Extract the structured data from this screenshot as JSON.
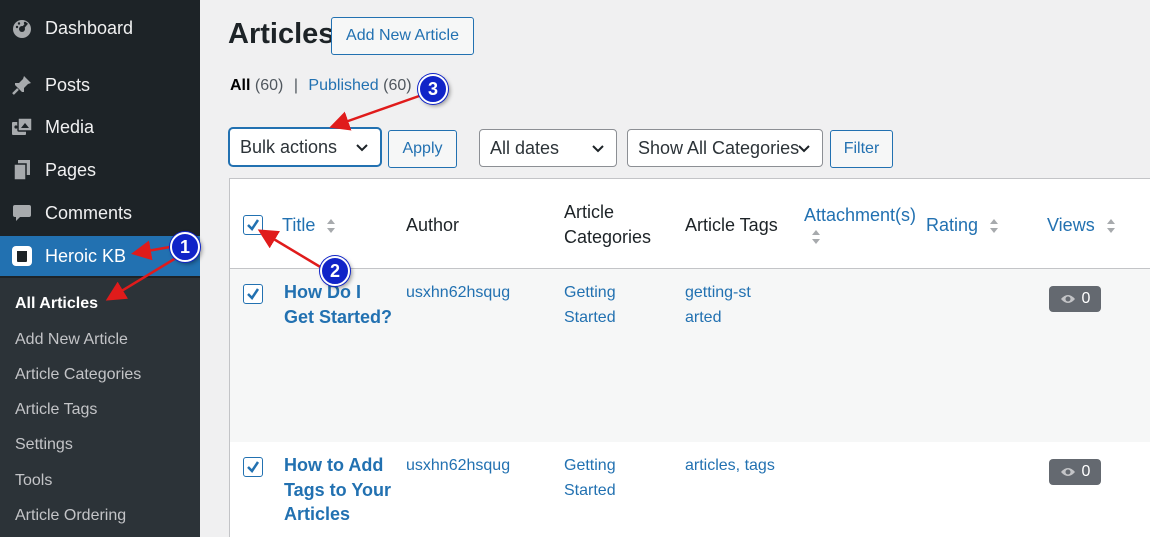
{
  "sidebar": {
    "items": [
      {
        "label": "Dashboard",
        "icon": "dashboard-icon"
      },
      {
        "label": "Posts",
        "icon": "pin-icon"
      },
      {
        "label": "Media",
        "icon": "media-icon"
      },
      {
        "label": "Pages",
        "icon": "pages-icon"
      },
      {
        "label": "Comments",
        "icon": "comment-icon"
      },
      {
        "label": "Heroic KB",
        "icon": "heroic-kb-icon"
      }
    ],
    "submenu": [
      "All Articles",
      "Add New Article",
      "Article Categories",
      "Article Tags",
      "Settings",
      "Tools",
      "Article Ordering"
    ]
  },
  "page": {
    "title": "Articles",
    "add_new_label": "Add New Article"
  },
  "filters": {
    "all_label": "All",
    "all_count": "(60)",
    "separator": "|",
    "published_label": "Published",
    "published_count": "(60)",
    "bulk_actions": "Bulk actions",
    "apply_label": "Apply",
    "dates": "All dates",
    "categories": "Show All Categories",
    "filter_label": "Filter"
  },
  "table": {
    "columns": {
      "title": "Title",
      "author": "Author",
      "categories": "Article Categories",
      "tags": "Article Tags",
      "attachments": "Attachment(s)",
      "rating": "Rating",
      "views": "Views"
    },
    "rows": [
      {
        "title": "How Do I Get Started?",
        "author": "usxhn62hsqug",
        "category": "Getting Started",
        "tags": "getting-started",
        "views": "0"
      },
      {
        "title": "How to Add Tags to Your Articles",
        "author": "usxhn62hsqug",
        "category": "Getting Started",
        "tags": "articles, tags",
        "views": "0"
      }
    ]
  },
  "callouts": [
    "1",
    "2",
    "3"
  ],
  "colors": {
    "sidebar_bg": "#1d2327",
    "submenu_bg": "#2c3338",
    "accent": "#2271b1",
    "page_bg": "#f0f0f1",
    "callout": "#1024c8",
    "arrow": "#e01b1b"
  }
}
